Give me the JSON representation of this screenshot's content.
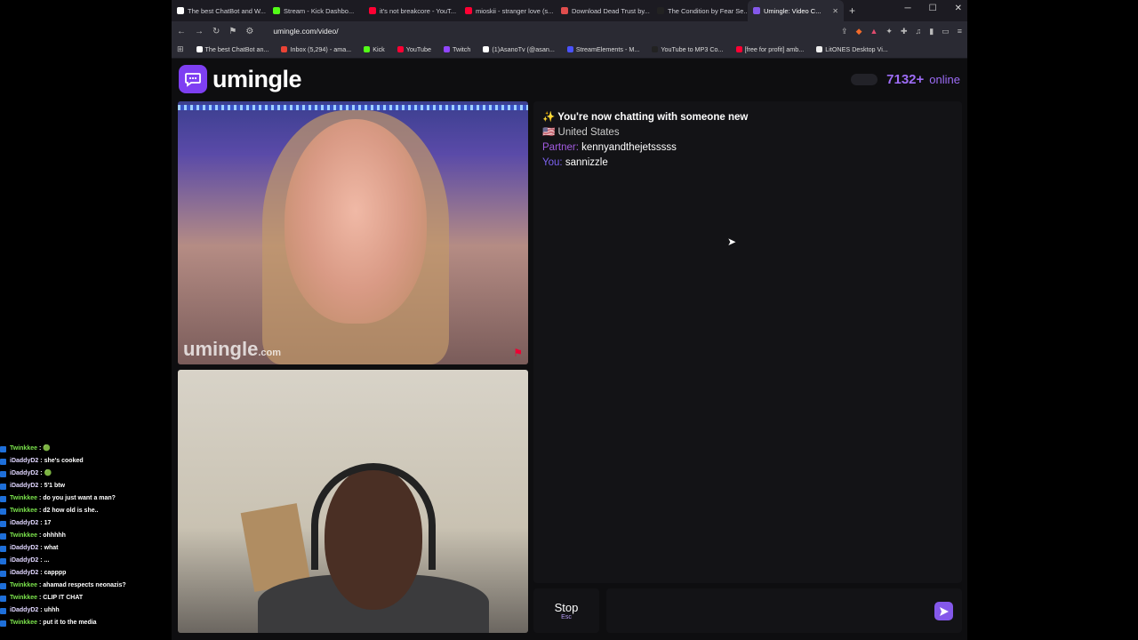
{
  "browser": {
    "tabs": [
      {
        "title": "The best ChatBot and W...",
        "color": "#ffffff"
      },
      {
        "title": "Stream - Kick Dashbo...",
        "color": "#53fc18"
      },
      {
        "title": "it's not breakcore - YouT...",
        "color": "#ff0033"
      },
      {
        "title": "mioskii - stranger love (s...",
        "color": "#ff0033"
      },
      {
        "title": "Download Dead Trust by...",
        "color": "#e04d4d"
      },
      {
        "title": "The Condition by Fear Se...",
        "color": "#222222"
      },
      {
        "title": "Umingle: Video C...",
        "color": "#8458ea",
        "active": true
      }
    ],
    "url": "umingle.com/video/",
    "bookmarks": [
      {
        "label": "The best ChatBot an...",
        "color": "#ffffff"
      },
      {
        "label": "Inbox (5,294) - ama...",
        "color": "#ea4335"
      },
      {
        "label": "Kick",
        "color": "#53fc18"
      },
      {
        "label": "YouTube",
        "color": "#ff0033"
      },
      {
        "label": "Twitch",
        "color": "#9146ff"
      },
      {
        "label": "(1)AsanoTv (@asan...",
        "color": "#ffffff"
      },
      {
        "label": "StreamElements - M...",
        "color": "#4a52ff"
      },
      {
        "label": "YouTube to MP3 Co...",
        "color": "#222222"
      },
      {
        "label": "[free for profit] amb...",
        "color": "#ff0033"
      },
      {
        "label": "LitONES Desktop Vi...",
        "color": "#eeeeee"
      }
    ]
  },
  "site": {
    "logo_text": "umingle",
    "online_count": "7132+",
    "online_label": "online",
    "watermark": "umingle",
    "watermark_tld": ".com",
    "accent": "#8458ea"
  },
  "chat": {
    "status": "✨ You're now chatting with someone new",
    "country_flag": "🇺🇸",
    "country": "United States",
    "partner_label": "Partner:",
    "partner_name": "kennyandthejetsssss",
    "you_label": "You:",
    "you_name": "sannizzle"
  },
  "controls": {
    "stop_label": "Stop",
    "stop_key": "Esc",
    "message_placeholder": ""
  },
  "stream_chat": [
    {
      "user": "Twinkkee",
      "text": ": 🟢"
    },
    {
      "user": "iDaddyD2",
      "text": ": she's cooked"
    },
    {
      "user": "iDaddyD2",
      "text": ": 🟢"
    },
    {
      "user": "iDaddyD2",
      "text": ": 5'1 btw"
    },
    {
      "user": "Twinkkee",
      "text": ": do you just want a man?"
    },
    {
      "user": "Twinkkee",
      "text": ": d2 how old is she.."
    },
    {
      "user": "iDaddyD2",
      "text": ": 17"
    },
    {
      "user": "Twinkkee",
      "text": ": ohhhhh"
    },
    {
      "user": "iDaddyD2",
      "text": ": what"
    },
    {
      "user": "iDaddyD2",
      "text": ": ..."
    },
    {
      "user": "iDaddyD2",
      "text": ": capppp"
    },
    {
      "user": "Twinkkee",
      "text": ": ahamad respects neonazis?"
    },
    {
      "user": "Twinkkee",
      "text": ": CLIP IT CHAT"
    },
    {
      "user": "iDaddyD2",
      "text": ": uhhh"
    },
    {
      "user": "Twinkkee",
      "text": ": put it to the media"
    }
  ]
}
